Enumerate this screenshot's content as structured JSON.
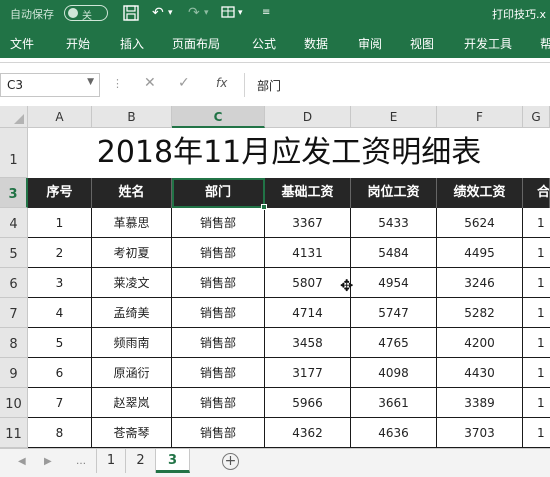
{
  "titlebar": {
    "autosave_label": "自动保存",
    "autosave_state": "关",
    "filename": "打印技巧.x",
    "icons": [
      "save-icon",
      "undo-icon",
      "redo-icon",
      "format-painter-icon",
      "customize-icon"
    ]
  },
  "ribbon_tabs": [
    "文件",
    "开始",
    "插入",
    "页面布局",
    "公式",
    "数据",
    "审阅",
    "视图",
    "开发工具",
    "帮"
  ],
  "formula_bar": {
    "name_box": "C3",
    "fx_label": "fx",
    "content": "部门"
  },
  "columns": [
    "A",
    "B",
    "C",
    "D",
    "E",
    "F",
    "G"
  ],
  "selected_column": "C",
  "rows": [
    "1",
    "3",
    "4",
    "5",
    "6",
    "7",
    "8",
    "9",
    "10",
    "11"
  ],
  "selected_row": "3",
  "sheet": {
    "title": "2018年11月应发工资明细表",
    "headers": [
      "序号",
      "姓名",
      "部门",
      "基础工资",
      "岗位工资",
      "绩效工资",
      "合"
    ],
    "data": [
      [
        "1",
        "革慕思",
        "销售部",
        "3367",
        "5433",
        "5624",
        "1"
      ],
      [
        "2",
        "考初夏",
        "销售部",
        "4131",
        "5484",
        "4495",
        "1"
      ],
      [
        "3",
        "莱凌文",
        "销售部",
        "5807",
        "4954",
        "3246",
        "1"
      ],
      [
        "4",
        "孟绮美",
        "销售部",
        "4714",
        "5747",
        "5282",
        "1"
      ],
      [
        "5",
        "频雨南",
        "销售部",
        "3458",
        "4765",
        "4200",
        "1"
      ],
      [
        "6",
        "原涵衍",
        "销售部",
        "3177",
        "4098",
        "4430",
        "1"
      ],
      [
        "7",
        "赵翠岚",
        "销售部",
        "5966",
        "3661",
        "3389",
        "1"
      ],
      [
        "8",
        "苍斋琴",
        "销售部",
        "4362",
        "4636",
        "3703",
        "1"
      ]
    ]
  },
  "sheet_tabs": [
    "1",
    "2",
    "3"
  ],
  "active_sheet": "3",
  "colors": {
    "accent": "#217346",
    "header_fill": "#262626"
  }
}
